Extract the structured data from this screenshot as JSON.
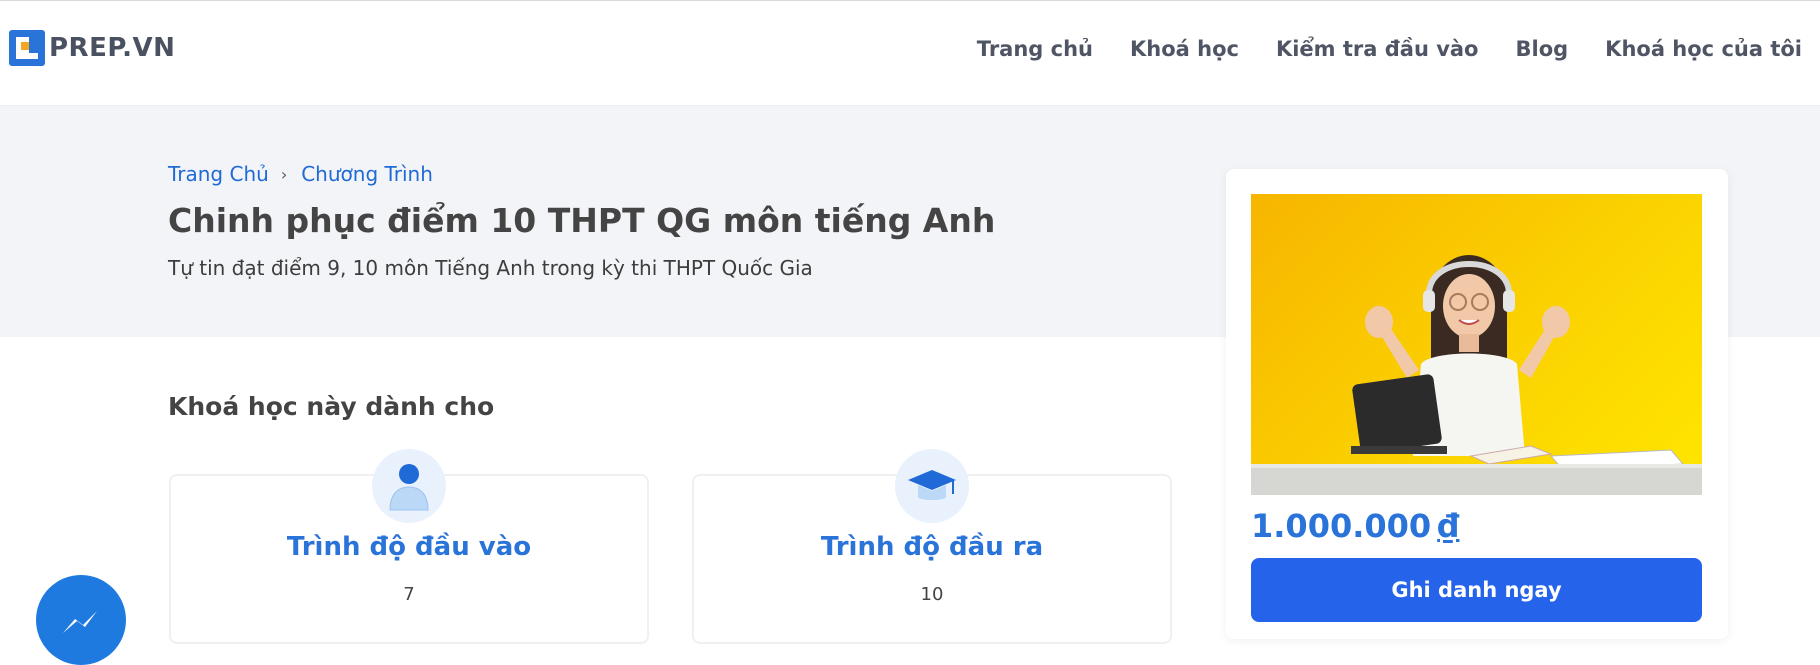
{
  "header": {
    "logo_text": "PREP.VN",
    "nav": [
      {
        "label": "Trang chủ"
      },
      {
        "label": "Khoá học"
      },
      {
        "label": "Kiểm tra đầu vào"
      },
      {
        "label": "Blog"
      },
      {
        "label": "Khoá học của tôi"
      }
    ]
  },
  "hero": {
    "breadcrumb": [
      "Trang Chủ",
      "Chương Trình"
    ],
    "title": "Chinh phục điểm 10 THPT QG môn tiếng Anh",
    "subtitle": "Tự tin đạt điểm 9, 10 môn Tiếng Anh trong kỳ thi THPT Quốc Gia"
  },
  "main": {
    "section_title": "Khoá học này dành cho",
    "cards": [
      {
        "title": "Trình độ đầu vào",
        "value": "7",
        "icon": "user-icon"
      },
      {
        "title": "Trình độ đầu ra",
        "value": "10",
        "icon": "graduation-cap-icon"
      }
    ]
  },
  "side": {
    "price": "1.000.000",
    "currency": "₫",
    "enroll_label": "Ghi danh ngay",
    "image_icon": "student-photo"
  },
  "colors": {
    "accent": "#2a73d9",
    "button": "#2563eb",
    "hero_bg": "#f3f4f7",
    "photo_bg": "#fbd200"
  }
}
